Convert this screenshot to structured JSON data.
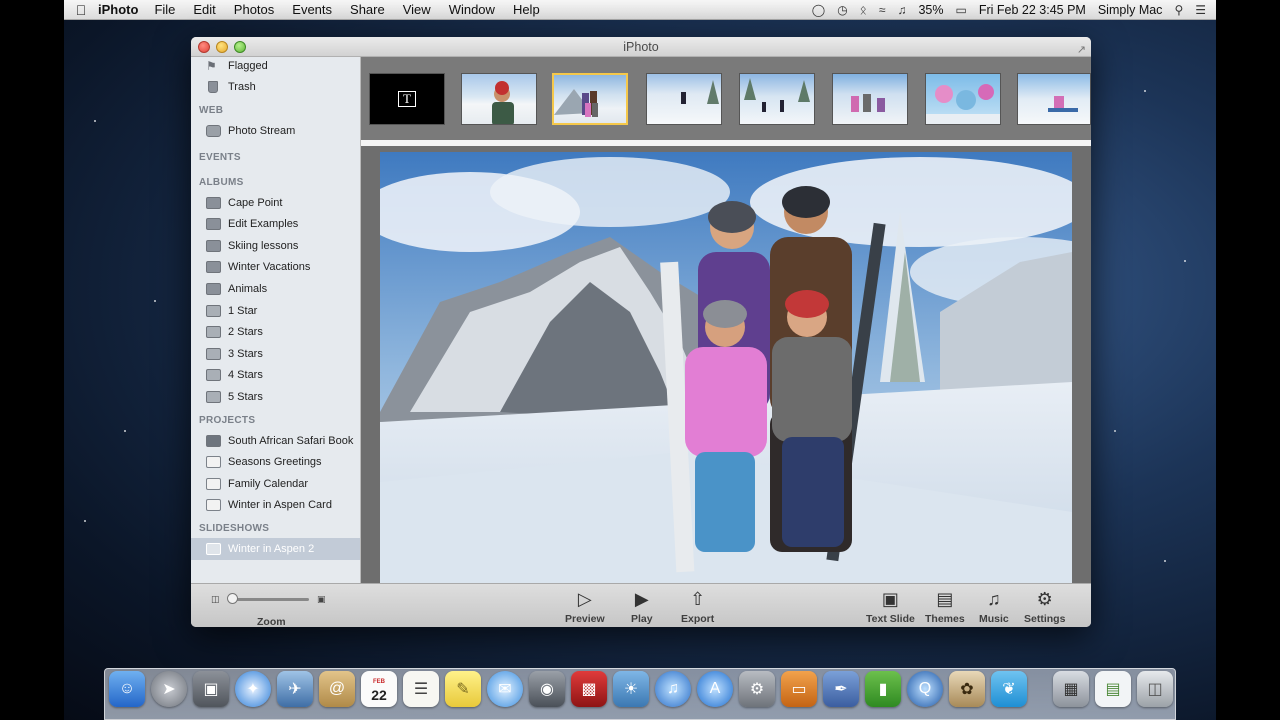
{
  "menubar": {
    "apple": "",
    "app_name": "iPhoto",
    "menus": [
      "File",
      "Edit",
      "Photos",
      "Events",
      "Share",
      "View",
      "Window",
      "Help"
    ],
    "battery": "35%",
    "clock": "Fri Feb 22  3:45 PM",
    "user": "Simply Mac"
  },
  "window": {
    "title": "iPhoto"
  },
  "sidebar": {
    "top_items": [
      {
        "label": "Flagged",
        "icon": "flag-icon"
      },
      {
        "label": "Trash",
        "icon": "trash-icon"
      }
    ],
    "web": {
      "header": "WEB",
      "items": [
        {
          "label": "Photo Stream",
          "icon": "photo-stream-icon"
        }
      ]
    },
    "events": {
      "header": "EVENTS"
    },
    "albums": {
      "header": "ALBUMS",
      "items": [
        {
          "label": "Cape Point",
          "icon": "album-icon"
        },
        {
          "label": "Edit Examples",
          "icon": "album-icon"
        },
        {
          "label": "Skiing lessons",
          "icon": "album-icon"
        },
        {
          "label": "Winter Vacations",
          "icon": "album-icon"
        },
        {
          "label": "Animals",
          "icon": "album-icon"
        },
        {
          "label": "1 Star",
          "icon": "smart-album-icon"
        },
        {
          "label": "2 Stars",
          "icon": "smart-album-icon"
        },
        {
          "label": "3 Stars",
          "icon": "smart-album-icon"
        },
        {
          "label": "4 Stars",
          "icon": "smart-album-icon"
        },
        {
          "label": "5 Stars",
          "icon": "smart-album-icon"
        }
      ]
    },
    "projects": {
      "header": "PROJECTS",
      "items": [
        {
          "label": "South African Safari Book",
          "icon": "book-icon"
        },
        {
          "label": "Seasons Greetings",
          "icon": "card-icon"
        },
        {
          "label": "Family Calendar",
          "icon": "calendar-icon"
        },
        {
          "label": "Winter in Aspen Card",
          "icon": "card-icon"
        }
      ]
    },
    "slideshows": {
      "header": "SLIDESHOWS",
      "items": [
        {
          "label": "Winter in Aspen 2",
          "icon": "slideshow-icon",
          "selected": true
        }
      ]
    }
  },
  "filmstrip": {
    "title_slide_glyph": "T",
    "selected_index": 2
  },
  "toolbar": {
    "zoom_label": "Zoom",
    "zoom_level": 0.0,
    "center": [
      {
        "label": "Preview",
        "icon": "preview-icon"
      },
      {
        "label": "Play",
        "icon": "play-icon"
      },
      {
        "label": "Export",
        "icon": "export-icon"
      }
    ],
    "right": [
      {
        "label": "Text Slide",
        "icon": "text-slide-icon"
      },
      {
        "label": "Themes",
        "icon": "themes-icon"
      },
      {
        "label": "Music",
        "icon": "music-icon"
      },
      {
        "label": "Settings",
        "icon": "gear-icon"
      }
    ]
  },
  "dock": {
    "calendar_day": "22",
    "calendar_month": "FEB",
    "items": [
      "finder-icon",
      "launchpad-icon",
      "image-capture-icon",
      "safari-icon",
      "mail-icon",
      "contacts-icon",
      "calendar-icon",
      "reminders-icon",
      "notes-icon",
      "messages-icon",
      "facetime-icon",
      "photo-booth-icon",
      "iphoto-icon",
      "itunes-icon",
      "app-store-icon",
      "system-preferences-icon",
      "keynote-icon",
      "pages-icon",
      "numbers-icon",
      "quicktime-icon",
      "owl-icon",
      "twitter-icon",
      "screenshot-icon",
      "preview-doc-icon",
      "trash-icon"
    ],
    "colors": {
      "blue": "#2f7fd8",
      "gray": "#8a8f96",
      "red": "#c9292b",
      "green": "#4ea43a",
      "yellow": "#f3d248"
    }
  }
}
